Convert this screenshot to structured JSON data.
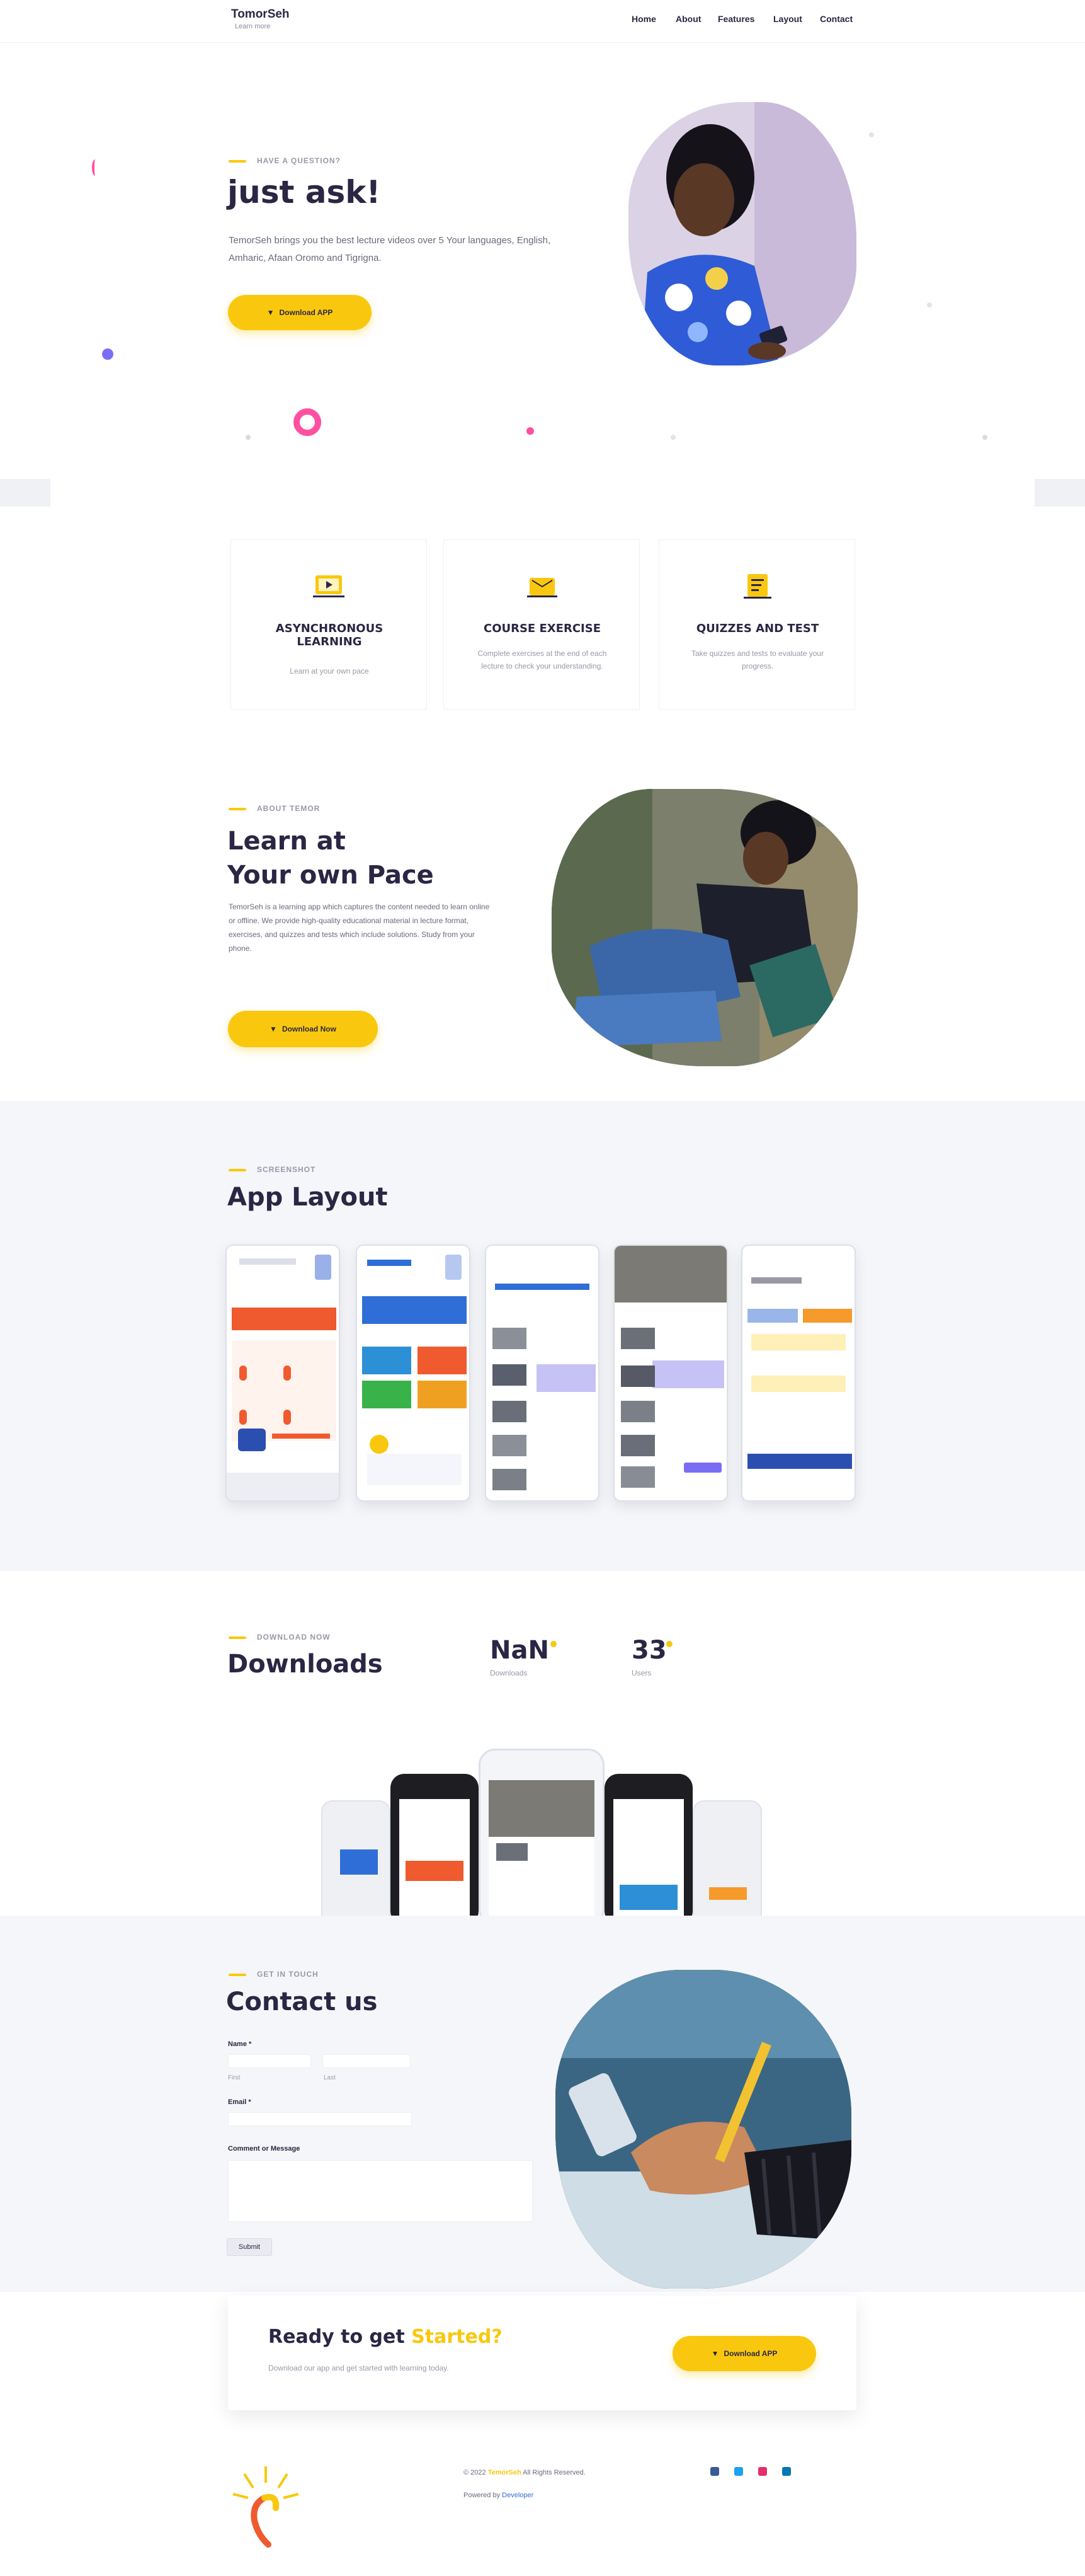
{
  "header": {
    "logo_title": "TomorSeh",
    "logo_sub": "Learn more",
    "nav": [
      "Home",
      "About",
      "Features",
      "Layout",
      "Contact"
    ]
  },
  "hero": {
    "kicker": "Have a question?",
    "title": "just ask!",
    "description": "TemorSeh brings you the best lecture videos over 5 Your languages, English, Amharic, Afaan Oromo and Tigrigna.",
    "button": "Download APP"
  },
  "features": [
    {
      "title": "ASYNCHRONOUS LEARNING",
      "desc": "Learn at your own pace",
      "icon": "video-lesson-icon"
    },
    {
      "title": "COURSE EXERCISE",
      "desc": "Complete exercises at the end of each lecture to check your understanding.",
      "icon": "exercise-book-icon"
    },
    {
      "title": "QUIZZES AND TEST",
      "desc": "Take quizzes and tests to evaluate your progress.",
      "icon": "quiz-icon"
    }
  ],
  "pace": {
    "kicker": "About Temor",
    "title_line1": "Learn at",
    "title_line2": "Your own Pace",
    "description": "TemorSeh is a learning app which captures the content needed to learn online or offline. We provide high-quality educational material in lecture format, exercises, and quizzes and tests which include solutions. Study from your phone.",
    "button": "Download Now"
  },
  "layout": {
    "kicker": "Screenshot",
    "title": "App Layout"
  },
  "downloads": {
    "kicker": "Download now",
    "title": "Downloads",
    "stat1_value": "NaN",
    "stat1_label": "Downloads",
    "stat2_value": "33",
    "stat2_label": "Users"
  },
  "contact": {
    "kicker": "Get in touch",
    "title": "Contact us",
    "name_label": "Name *",
    "first_sub": "First",
    "last_sub": "Last",
    "email_label": "Email *",
    "comment_label": "Comment or Message",
    "submit": "Submit"
  },
  "cta": {
    "title_part1": "Ready to get ",
    "title_part2": "Started?",
    "subtitle": "Download our app and get started with learning today.",
    "button": "Download APP"
  },
  "footer": {
    "copyright_prefix": "© 2022",
    "brand": "TemorSeh",
    "copyright_suffix": "All Rights Reserved.",
    "powered_prefix": "Powered by",
    "powered_by": "Developer"
  },
  "colors": {
    "accent": "#f9c80e",
    "navy": "#2a2644",
    "purple": "#7b6cf6",
    "pink": "#ff4fa0"
  }
}
